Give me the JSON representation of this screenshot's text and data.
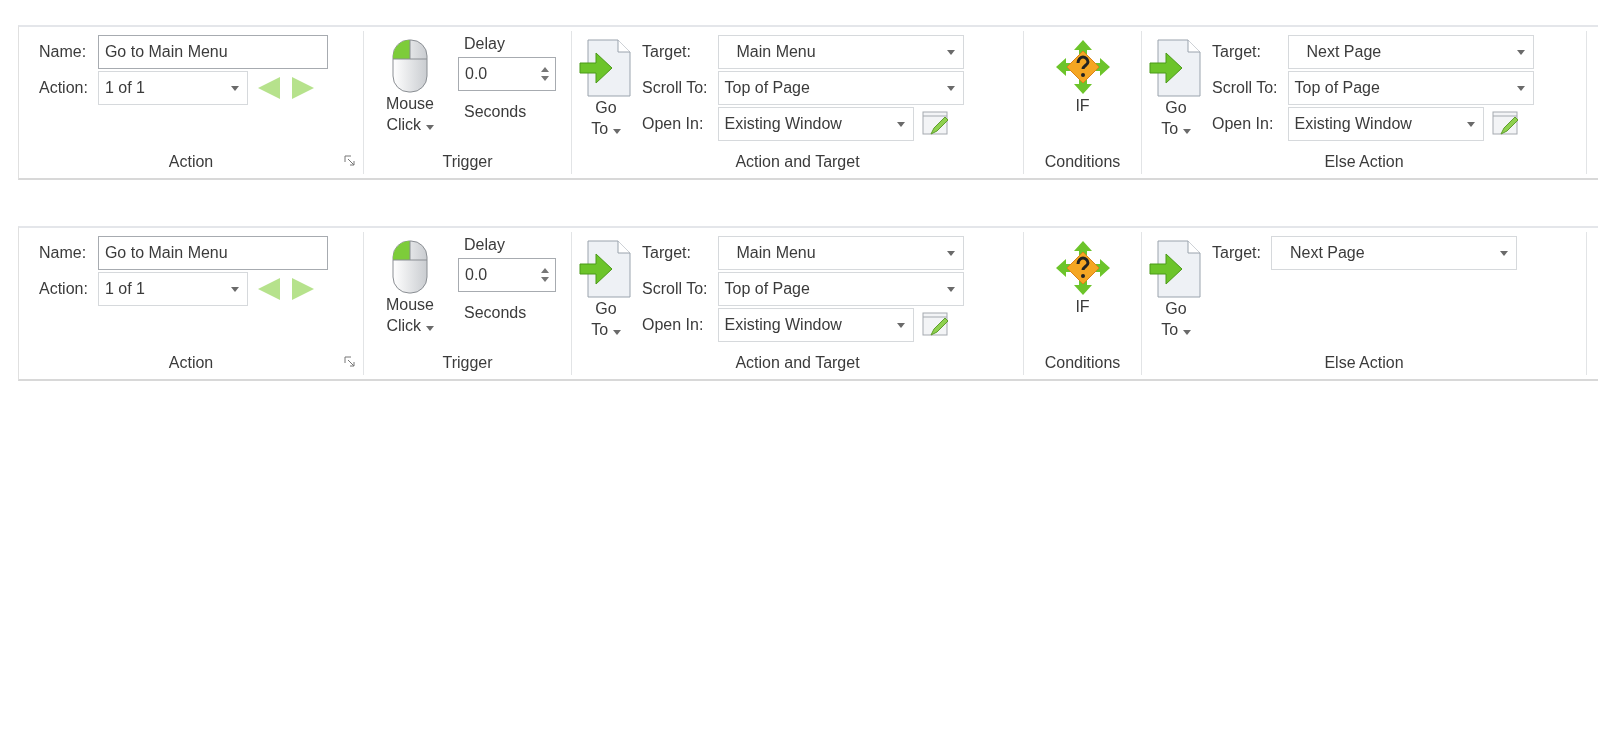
{
  "ribbons": [
    {
      "action": {
        "title": "Action",
        "name_label": "Name:",
        "name_value": "Go to Main Menu",
        "action_label": "Action:",
        "action_value": "1 of 1"
      },
      "trigger": {
        "title": "Trigger",
        "button": [
          "Mouse",
          "Click"
        ],
        "delay_label": "Delay",
        "delay_value": "0.0",
        "unit": "Seconds"
      },
      "action_and_target": {
        "title": "Action and Target",
        "button": [
          "Go",
          "To"
        ],
        "fields": [
          {
            "label": "Target:",
            "value": "Main Menu",
            "kind": "dropdown"
          },
          {
            "label": "Scroll To:",
            "value": "Top of Page",
            "kind": "dropdown"
          },
          {
            "label": "Open In:",
            "value": "Existing Window",
            "kind": "dropdown-edit"
          }
        ]
      },
      "conditions": {
        "title": "Conditions",
        "button": "IF"
      },
      "else_action": {
        "title": "Else Action",
        "button": [
          "Go",
          "To"
        ],
        "fields": [
          {
            "label": "Target:",
            "value": "Next Page",
            "kind": "dropdown"
          },
          {
            "label": "Scroll To:",
            "value": "Top of Page",
            "kind": "dropdown"
          },
          {
            "label": "Open In:",
            "value": "Existing Window",
            "kind": "dropdown-edit"
          }
        ]
      }
    },
    {
      "action": {
        "title": "Action",
        "name_label": "Name:",
        "name_value": "Go to Main Menu",
        "action_label": "Action:",
        "action_value": "1 of 1"
      },
      "trigger": {
        "title": "Trigger",
        "button": [
          "Mouse",
          "Click"
        ],
        "delay_label": "Delay",
        "delay_value": "0.0",
        "unit": "Seconds"
      },
      "action_and_target": {
        "title": "Action and Target",
        "button": [
          "Go",
          "To"
        ],
        "fields": [
          {
            "label": "Target:",
            "value": "Main Menu",
            "kind": "dropdown"
          },
          {
            "label": "Scroll To:",
            "value": "Top of Page",
            "kind": "dropdown"
          },
          {
            "label": "Open In:",
            "value": "Existing Window",
            "kind": "dropdown-edit"
          }
        ]
      },
      "conditions": {
        "title": "Conditions",
        "button": "IF"
      },
      "else_action": {
        "title": "Else Action",
        "button": [
          "Go",
          "To"
        ],
        "fields": [
          {
            "label": "Target:",
            "value": "Next Page",
            "kind": "dropdown"
          }
        ]
      }
    }
  ]
}
